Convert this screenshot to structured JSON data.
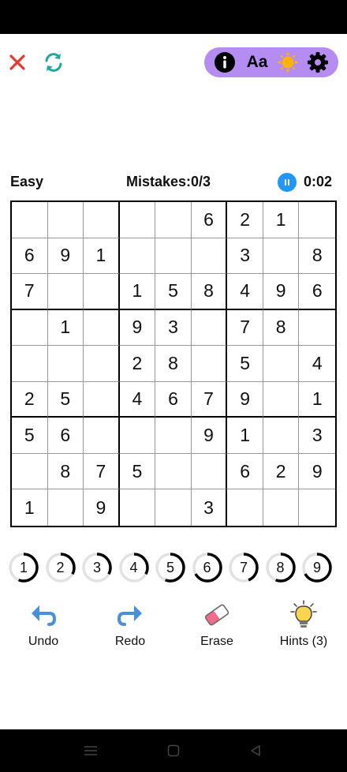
{
  "toolbar": {
    "close_icon": "close-icon",
    "restart_icon": "refresh-icon",
    "font_label": "Aa",
    "accent_color": "#b58cf2",
    "close_color": "#e53935",
    "restart_color": "#26a69a"
  },
  "game": {
    "difficulty": "Easy",
    "mistakes": "Mistakes:0/3",
    "timer": "0:02",
    "pause_color": "#2196f3"
  },
  "board": [
    [
      "",
      "",
      "",
      "",
      "",
      "6",
      "2",
      "1",
      ""
    ],
    [
      "6",
      "9",
      "1",
      "",
      "",
      "",
      "3",
      "",
      "8"
    ],
    [
      "7",
      "",
      "",
      "1",
      "5",
      "8",
      "4",
      "9",
      "6"
    ],
    [
      "",
      "1",
      "",
      "9",
      "3",
      "",
      "7",
      "8",
      ""
    ],
    [
      "",
      "",
      "",
      "2",
      "8",
      "",
      "5",
      "",
      "4"
    ],
    [
      "2",
      "5",
      "",
      "4",
      "6",
      "7",
      "9",
      "",
      "1"
    ],
    [
      "5",
      "6",
      "",
      "",
      "",
      "9",
      "1",
      "",
      "3"
    ],
    [
      "",
      "8",
      "7",
      "5",
      "",
      "",
      "6",
      "2",
      "9"
    ],
    [
      "1",
      "",
      "9",
      "",
      "",
      "3",
      "",
      "",
      ""
    ]
  ],
  "numpad": [
    {
      "label": "1",
      "progress": 0.56
    },
    {
      "label": "2",
      "progress": 0.33
    },
    {
      "label": "3",
      "progress": 0.33
    },
    {
      "label": "4",
      "progress": 0.33
    },
    {
      "label": "5",
      "progress": 0.56
    },
    {
      "label": "6",
      "progress": 0.67
    },
    {
      "label": "7",
      "progress": 0.44
    },
    {
      "label": "8",
      "progress": 0.56
    },
    {
      "label": "9",
      "progress": 0.67
    }
  ],
  "actions": {
    "undo": "Undo",
    "redo": "Redo",
    "erase": "Erase",
    "hints": "Hints (3)"
  }
}
